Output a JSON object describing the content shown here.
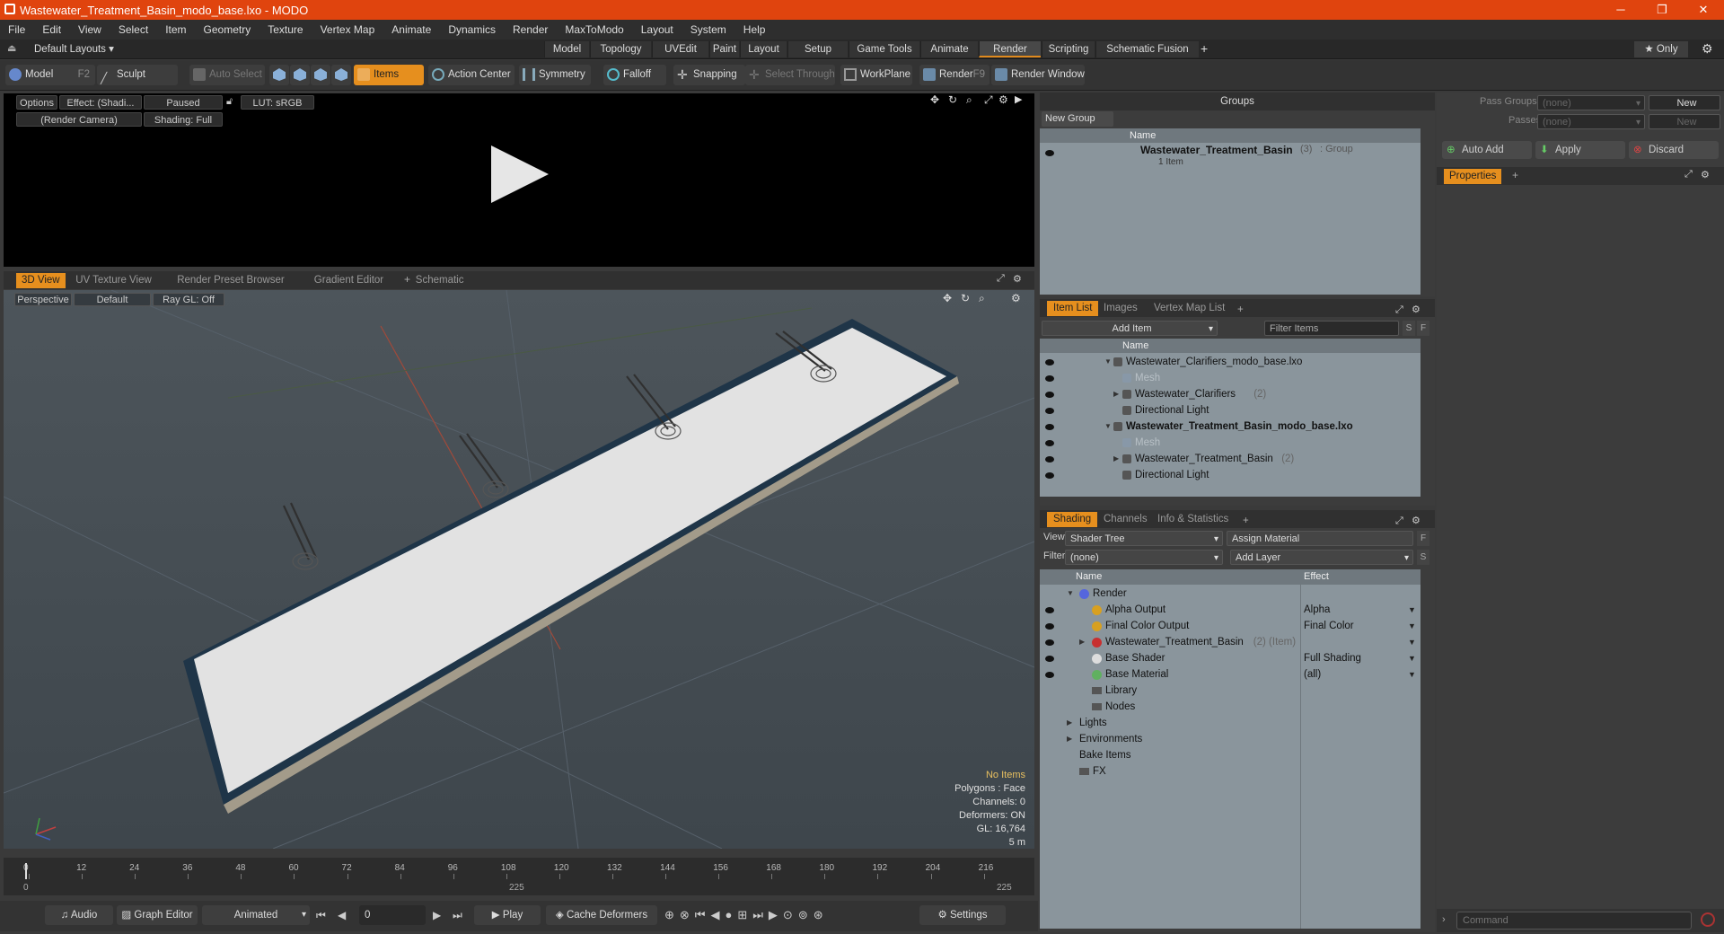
{
  "title": "Wastewater_Treatment_Basin_modo_base.lxo - MODO",
  "win": {
    "min": "─",
    "max": "❐",
    "close": "✕"
  },
  "menu": [
    "File",
    "Edit",
    "View",
    "Select",
    "Item",
    "Geometry",
    "Texture",
    "Vertex Map",
    "Animate",
    "Dynamics",
    "Render",
    "MaxToModo",
    "Layout",
    "System",
    "Help"
  ],
  "layout": {
    "default": "Default Layouts ▾",
    "tabs": [
      "Model",
      "Topology",
      "UVEdit",
      "Paint",
      "Layout",
      "Setup",
      "Game Tools",
      "Animate",
      "Render",
      "Scripting",
      "Schematic Fusion"
    ],
    "add": "+",
    "only": "★ Only"
  },
  "toolbar": {
    "model": "Model",
    "model_key": "F2",
    "sculpt": "Sculpt",
    "auto_select": "Auto Select",
    "items": "Items",
    "action_center": "Action Center",
    "symmetry": "Symmetry",
    "falloff": "Falloff",
    "snapping": "Snapping",
    "select_through": "Select Through",
    "workplane": "WorkPlane",
    "render": "Render",
    "render_key": "F9",
    "render_window": "Render Window"
  },
  "renderview": {
    "options": "Options",
    "effect": "Effect: (Shadi...",
    "paused": "Paused",
    "lut": "LUT: sRGB",
    "camera": "(Render Camera)",
    "shading": "Shading: Full"
  },
  "vptabs": [
    "3D View",
    "UV Texture View",
    "Render Preset Browser",
    "Gradient Editor",
    "Schematic"
  ],
  "viewport": {
    "perspective": "Perspective",
    "default": "Default",
    "raygl": "Ray GL: Off"
  },
  "stats": {
    "no_items": "No Items",
    "polygons": "Polygons : Face",
    "channels": "Channels: 0",
    "deformers": "Deformers: ON",
    "gl": "GL: 16,764",
    "scale": "5 m"
  },
  "timeline": {
    "ticks": [
      "0",
      "12",
      "24",
      "36",
      "48",
      "60",
      "72",
      "84",
      "96",
      "108",
      "120",
      "132",
      "144",
      "156",
      "168",
      "180",
      "192",
      "204",
      "216"
    ],
    "start": "0",
    "mid": "225",
    "end": "225"
  },
  "bottom": {
    "audio": "Audio",
    "graph_editor": "Graph Editor",
    "animated": "Animated",
    "frame": "0",
    "play": "Play",
    "cache_deformers": "Cache Deformers",
    "settings": "Settings"
  },
  "groups": {
    "title": "Groups",
    "new_group": "New Group",
    "name_col": "Name",
    "item_name": "Wastewater_Treatment_Basin",
    "item_count": "(3)",
    "item_type": ": Group",
    "item_sub": "1 Item"
  },
  "passes": {
    "pass_groups_label": "Pass Groups",
    "pass_groups_val": "(none)",
    "passes_label": "Passes",
    "passes_val": "(none)",
    "new": "New",
    "new2": "New",
    "auto_add": "Auto Add",
    "apply": "Apply",
    "discard": "Discard",
    "properties": "Properties"
  },
  "itemlist": {
    "tabs": [
      "Item List",
      "Images",
      "Vertex Map List"
    ],
    "add_item": "Add Item",
    "filter": "Filter Items",
    "name_col": "Name",
    "rows": [
      {
        "label": "Wastewater_Clarifiers_modo_base.lxo",
        "extra": "",
        "indent": 0,
        "bold": false,
        "dim": false,
        "exp": "▼"
      },
      {
        "label": "Mesh",
        "extra": "",
        "indent": 1,
        "bold": false,
        "dim": true,
        "exp": ""
      },
      {
        "label": "Wastewater_Clarifiers",
        "extra": "(2)",
        "indent": 1,
        "bold": false,
        "dim": false,
        "exp": "▶"
      },
      {
        "label": "Directional Light",
        "extra": "",
        "indent": 1,
        "bold": false,
        "dim": false,
        "exp": ""
      },
      {
        "label": "Wastewater_Treatment_Basin_modo_base.lxo",
        "extra": "",
        "indent": 0,
        "bold": true,
        "dim": false,
        "exp": "▼"
      },
      {
        "label": "Mesh",
        "extra": "",
        "indent": 1,
        "bold": false,
        "dim": true,
        "exp": ""
      },
      {
        "label": "Wastewater_Treatment_Basin",
        "extra": "(2)",
        "indent": 1,
        "bold": false,
        "dim": false,
        "exp": "▶"
      },
      {
        "label": "Directional Light",
        "extra": "",
        "indent": 1,
        "bold": false,
        "dim": false,
        "exp": ""
      }
    ]
  },
  "shading": {
    "tabs": [
      "Shading",
      "Channels",
      "Info & Statistics"
    ],
    "view_label": "View",
    "view_val": "Shader Tree",
    "assign": "Assign Material",
    "filter_label": "Filter",
    "filter_val": "(none)",
    "add_layer": "Add Layer",
    "name_col": "Name",
    "effect_col": "Effect",
    "rows": [
      {
        "label": "Render",
        "effect": "",
        "indent": 0,
        "exp": "▼",
        "eye": false,
        "color": "#5566dd"
      },
      {
        "label": "Alpha Output",
        "effect": "Alpha",
        "indent": 1,
        "exp": "",
        "eye": true,
        "color": "#d8a020"
      },
      {
        "label": "Final Color Output",
        "effect": "Final Color",
        "indent": 1,
        "exp": "",
        "eye": true,
        "color": "#d8a020"
      },
      {
        "label": "Wastewater_Treatment_Basin",
        "extra": "(2) (Item)",
        "effect": "",
        "indent": 1,
        "exp": "▶",
        "eye": true,
        "color": "#c83030"
      },
      {
        "label": "Base Shader",
        "effect": "Full Shading",
        "indent": 1,
        "exp": "",
        "eye": true,
        "color": "#dddddd"
      },
      {
        "label": "Base Material",
        "effect": "(all)",
        "indent": 1,
        "exp": "",
        "eye": true,
        "color": "#60b060"
      },
      {
        "label": "Library",
        "effect": "",
        "indent": 1,
        "exp": "",
        "eye": false,
        "color": ""
      },
      {
        "label": "Nodes",
        "effect": "",
        "indent": 1,
        "exp": "",
        "eye": false,
        "color": ""
      },
      {
        "label": "Lights",
        "effect": "",
        "indent": 0,
        "exp": "▶",
        "eye": false,
        "color": ""
      },
      {
        "label": "Environments",
        "effect": "",
        "indent": 0,
        "exp": "▶",
        "eye": false,
        "color": ""
      },
      {
        "label": "Bake Items",
        "effect": "",
        "indent": 0,
        "exp": "",
        "eye": false,
        "color": ""
      },
      {
        "label": "FX",
        "effect": "",
        "indent": 0,
        "exp": "",
        "eye": false,
        "color": ""
      }
    ]
  },
  "command": {
    "placeholder": "Command"
  }
}
